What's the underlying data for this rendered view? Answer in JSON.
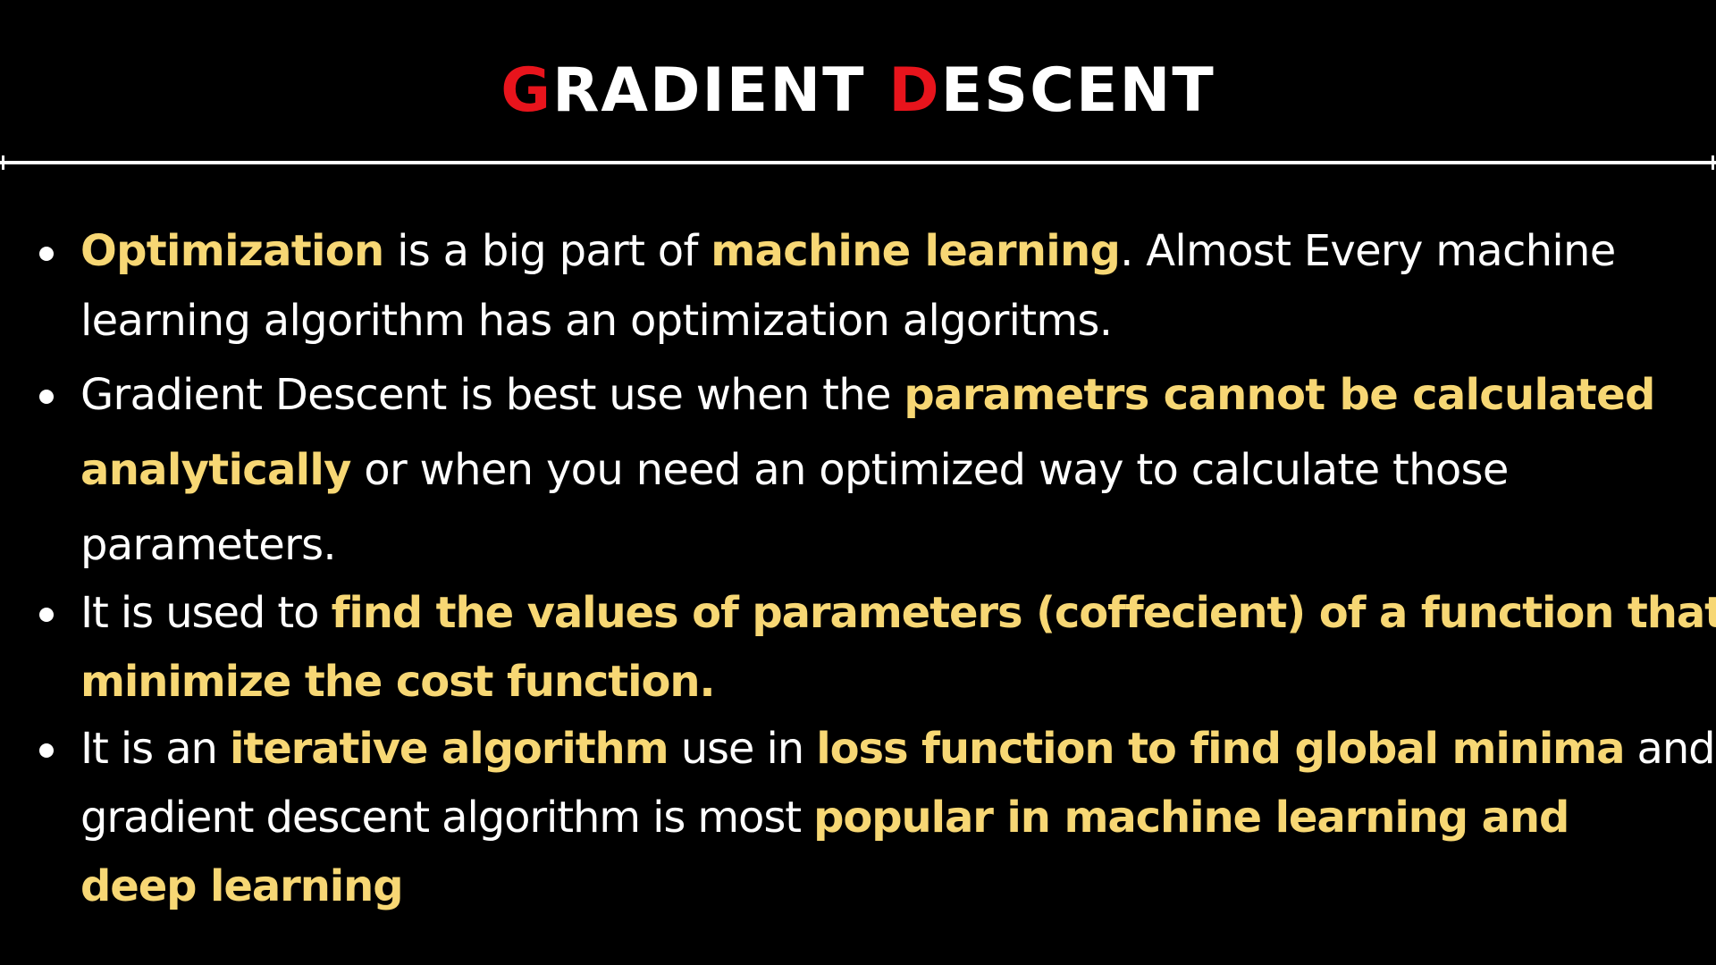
{
  "slide": {
    "title": {
      "word1_cap": "G",
      "word1_rest": "RADIENT",
      "word2_cap": "D",
      "word2_rest": "ESCENT"
    },
    "colors": {
      "background": "#000000",
      "text": "#ffffff",
      "highlight": "#f7d774",
      "title_accent": "#e8141c"
    },
    "bullets": [
      {
        "lines": [
          [
            {
              "text": "Optimization",
              "style": "highlight"
            },
            {
              "text": " is a big part of ",
              "style": "plain"
            },
            {
              "text": "machine learning",
              "style": "highlight"
            },
            {
              "text": ". Almost Every machine",
              "style": "plain"
            }
          ],
          [
            {
              "text": "learning algorithm has an optimization algoritms.",
              "style": "plain"
            }
          ]
        ]
      },
      {
        "lines": [
          [
            {
              "text": " Gradient Descent is best use when the ",
              "style": "plain"
            },
            {
              "text": "parametrs cannot be calculated",
              "style": "highlight"
            }
          ],
          [
            {
              "text": "analytically",
              "style": "highlight"
            },
            {
              "text": " or when you need an optimized way to calculate those",
              "style": "plain"
            }
          ],
          [
            {
              "text": "parameters.",
              "style": "plain"
            }
          ]
        ]
      },
      {
        "lines": [
          [
            {
              "text": "It is used to ",
              "style": "plain"
            },
            {
              "text": "find the values of parameters (coffecient) of a function that",
              "style": "highlight"
            }
          ],
          [
            {
              "text": "minimize the cost function.",
              "style": "highlight"
            }
          ]
        ]
      },
      {
        "lines": [
          [
            {
              "text": "It is an ",
              "style": "plain"
            },
            {
              "text": "iterative algorithm",
              "style": "highlight"
            },
            {
              "text": "  use in ",
              "style": "plain"
            },
            {
              "text": "loss function to find global minima",
              "style": "highlight"
            },
            {
              "text": " and",
              "style": "plain"
            }
          ],
          [
            {
              "text": "gradient  descent algorithm is most ",
              "style": "plain"
            },
            {
              "text": "popular in machine learning and",
              "style": "highlight"
            }
          ],
          [
            {
              "text": "deep learning",
              "style": "highlight"
            }
          ]
        ]
      }
    ]
  }
}
